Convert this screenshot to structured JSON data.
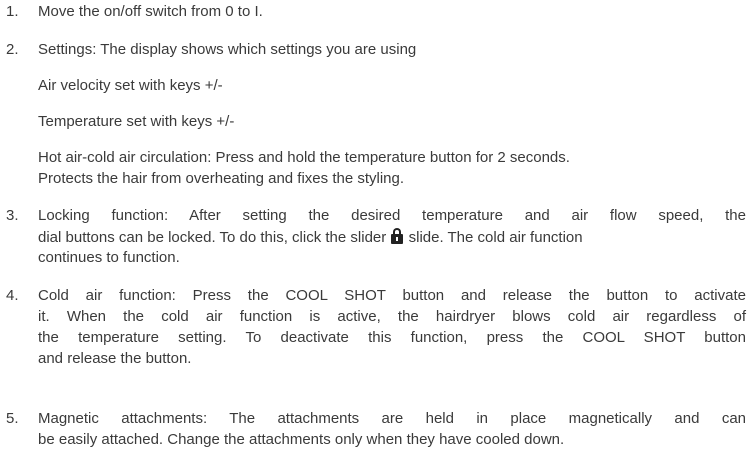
{
  "items": [
    {
      "number": "1.",
      "lines": [
        "Move the on/off switch from 0 to I."
      ]
    },
    {
      "number": "2.",
      "lines": [
        "Settings: The display shows which settings you are using",
        "Air velocity set with keys +/-",
        "Temperature set with keys +/-",
        "Hot air-cold air circulation: Press and hold the temperature button for 2 seconds.",
        "Protects the hair from overheating and fixes the styling."
      ]
    },
    {
      "number": "3.",
      "lines": [
        "Locking function: After setting the desired temperature and air flow speed, the",
        "dial buttons can be locked. To do this, click the slider",
        "slide. The cold air function",
        "continues to function."
      ],
      "icon": "lock-icon"
    },
    {
      "number": "4.",
      "lines": [
        "Cold air function: Press the COOL SHOT button  and release the button to activate",
        "it. When the cold air function is active, the hairdryer blows cold air regardless of",
        "the temperature setting. To deactivate this function, press the COOL SHOT button",
        "and release the button."
      ]
    },
    {
      "number": "5.",
      "lines": [
        "Magnetic attachments: The attachments are held in place magnetically and can",
        "be easily attached. Change the attachments only when they have cooled down."
      ]
    }
  ]
}
